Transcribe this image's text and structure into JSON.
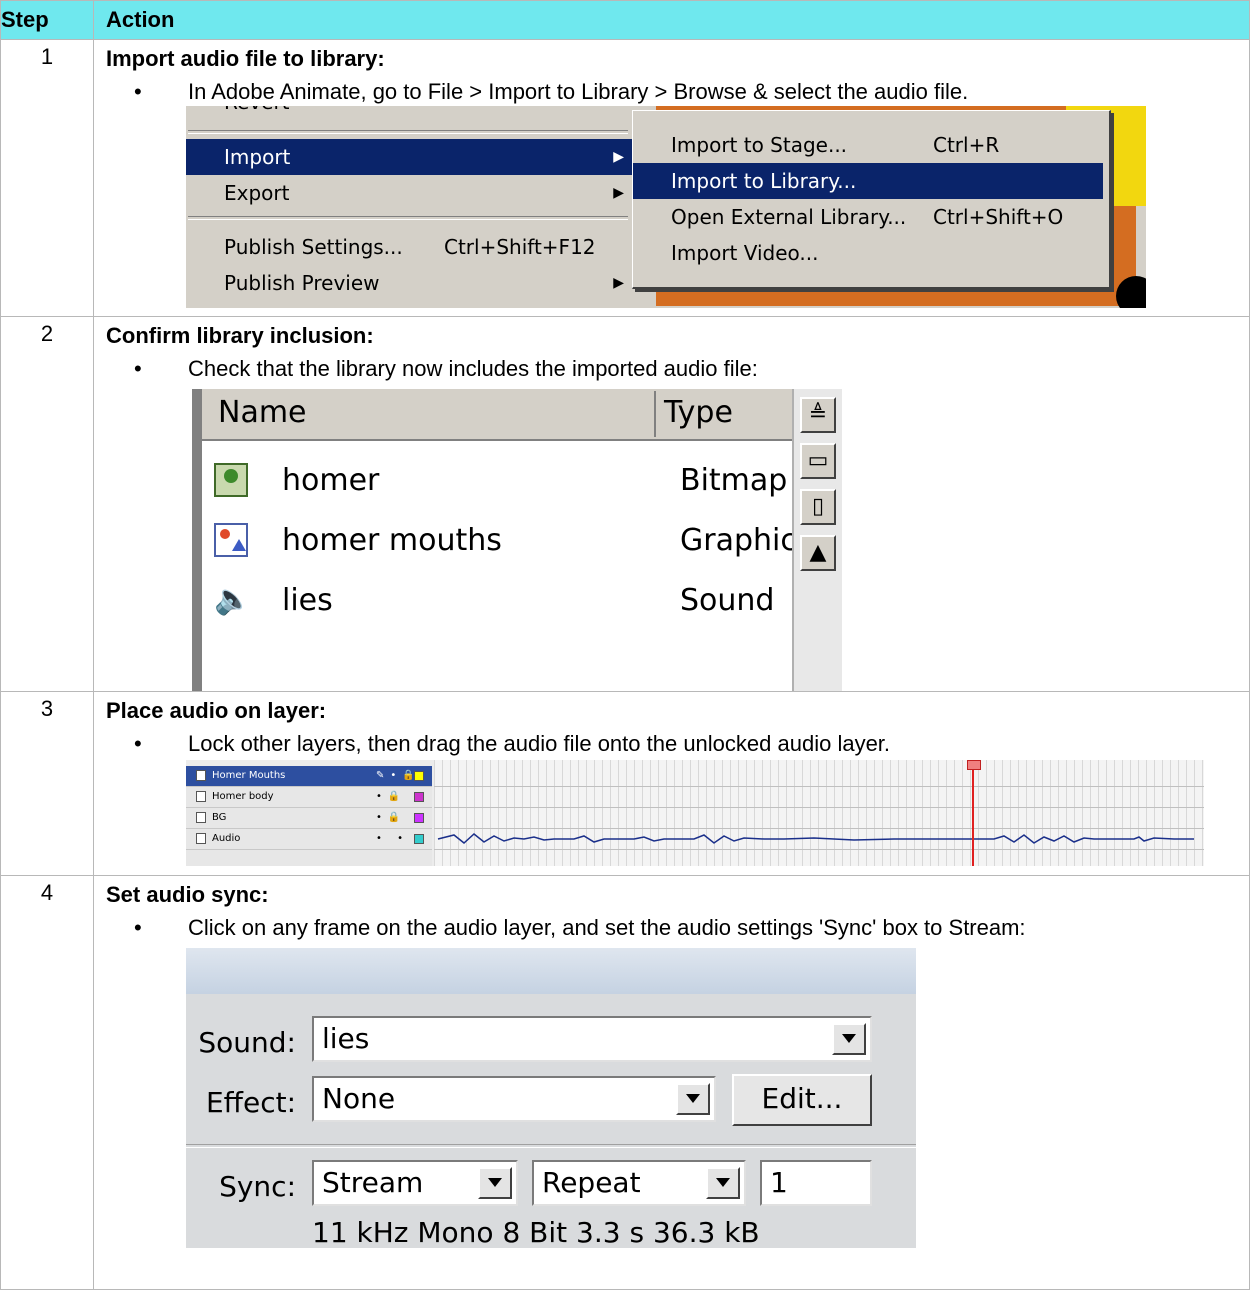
{
  "table": {
    "header": {
      "step": "Step",
      "action": "Action"
    },
    "steps": [
      {
        "number": "1",
        "title": "Import audio file to library:",
        "bullet": "In Adobe Animate, go to File > Import to Library > Browse & select the audio file."
      },
      {
        "number": "2",
        "title": "Confirm library inclusion:",
        "bullet": "Check that the library now includes the imported audio file:"
      },
      {
        "number": "3",
        "title": "Place audio on layer:",
        "bullet": "Lock other layers, then drag the audio file onto the unlocked audio layer."
      },
      {
        "number": "4",
        "title": "Set audio sync:",
        "bullet": "Click on any frame on the audio layer, and set the audio settings 'Sync' box to Stream:"
      }
    ]
  },
  "menu_screenshot": {
    "top_partial": "Revert",
    "items": [
      {
        "label": "Import",
        "shortcut": "",
        "submenu": true,
        "selected": true
      },
      {
        "label": "Export",
        "shortcut": "",
        "submenu": true,
        "selected": false
      },
      {
        "label": "Publish Settings...",
        "shortcut": "Ctrl+Shift+F12",
        "submenu": false,
        "selected": false
      },
      {
        "label": "Publish Preview",
        "shortcut": "",
        "submenu": true,
        "selected": false
      }
    ],
    "submenu_items": [
      {
        "label": "Import to Stage...",
        "shortcut": "Ctrl+R",
        "selected": false
      },
      {
        "label": "Import to Library...",
        "shortcut": "",
        "selected": true
      },
      {
        "label": "Open External Library...",
        "shortcut": "Ctrl+Shift+O",
        "selected": false
      },
      {
        "label": "Import Video...",
        "shortcut": "",
        "selected": false
      }
    ]
  },
  "library_screenshot": {
    "col_name": "Name",
    "col_type": "Type",
    "items": [
      {
        "name": "homer",
        "type": "Bitmap",
        "icon": "bitmap-icon"
      },
      {
        "name": "homer mouths",
        "type": "Graphic",
        "icon": "graphic-icon"
      },
      {
        "name": "lies",
        "type": "Sound",
        "icon": "sound-icon"
      }
    ]
  },
  "timeline_screenshot": {
    "layers": [
      {
        "name": "Homer Mouths",
        "selected": true,
        "locked": false,
        "color": "#ffff00"
      },
      {
        "name": "Homer body",
        "selected": false,
        "locked": true,
        "color": "#cc33cc"
      },
      {
        "name": "BG",
        "selected": false,
        "locked": true,
        "color": "#cc33ff"
      },
      {
        "name": "Audio",
        "selected": false,
        "locked": false,
        "color": "#33cccc"
      }
    ]
  },
  "properties_screenshot": {
    "sound_label": "Sound:",
    "sound_value": "lies",
    "effect_label": "Effect:",
    "effect_value": "None",
    "edit_button": "Edit...",
    "sync_label": "Sync:",
    "sync_value": "Stream",
    "repeat_value": "Repeat",
    "repeat_count": "1",
    "info": "11 kHz Mono 8 Bit 3.3 s 36.3 kB"
  },
  "colors": {
    "header_bg": "#6fe8ee",
    "menu_highlight": "#0a246a",
    "menu_bg": "#d4d0c8"
  }
}
